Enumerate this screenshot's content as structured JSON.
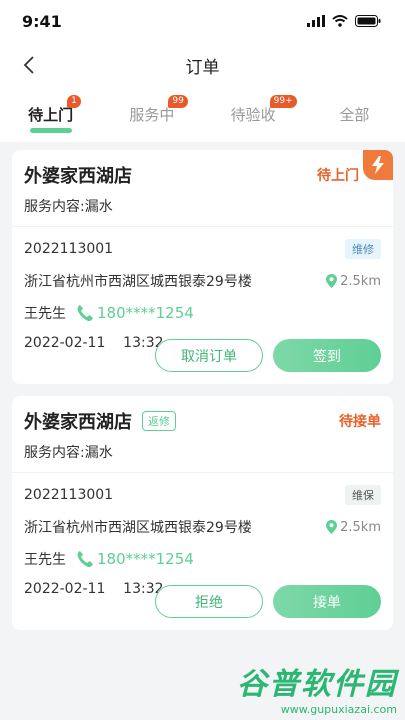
{
  "status_bar": {
    "time": "9:41"
  },
  "nav": {
    "title": "订单"
  },
  "tabs": [
    {
      "label": "待上门",
      "badge": "1",
      "active": true
    },
    {
      "label": "服务中",
      "badge": "99",
      "active": false
    },
    {
      "label": "待验收",
      "badge": "99+",
      "active": false
    },
    {
      "label": "全部",
      "badge": "",
      "active": false
    }
  ],
  "orders": [
    {
      "shop": "外婆家西湖店",
      "tag": "",
      "status": "待上门",
      "service": "服务内容:漏水",
      "order_no": "2022113001",
      "type": "维修",
      "address": "浙江省杭州市西湖区城西银泰29号楼",
      "distance": "2.5km",
      "contact": "王先生",
      "phone": "180****1254",
      "datetime": "2022-02-11    13:32",
      "btn_secondary": "取消订单",
      "btn_primary": "签到"
    },
    {
      "shop": "外婆家西湖店",
      "tag": "返修",
      "status": "待接单",
      "service": "服务内容:漏水",
      "order_no": "2022113001",
      "type": "维保",
      "address": "浙江省杭州市西湖区城西银泰29号楼",
      "distance": "2.5km",
      "contact": "王先生",
      "phone": "180****1254",
      "datetime": "2022-02-11    13:32",
      "btn_secondary": "拒绝",
      "btn_primary": "接单"
    }
  ],
  "watermark": {
    "main": "谷普软件园",
    "url": "www.gupuxiazai.com"
  },
  "colors": {
    "accent": "#5fcf95",
    "warning": "#e8632a"
  }
}
